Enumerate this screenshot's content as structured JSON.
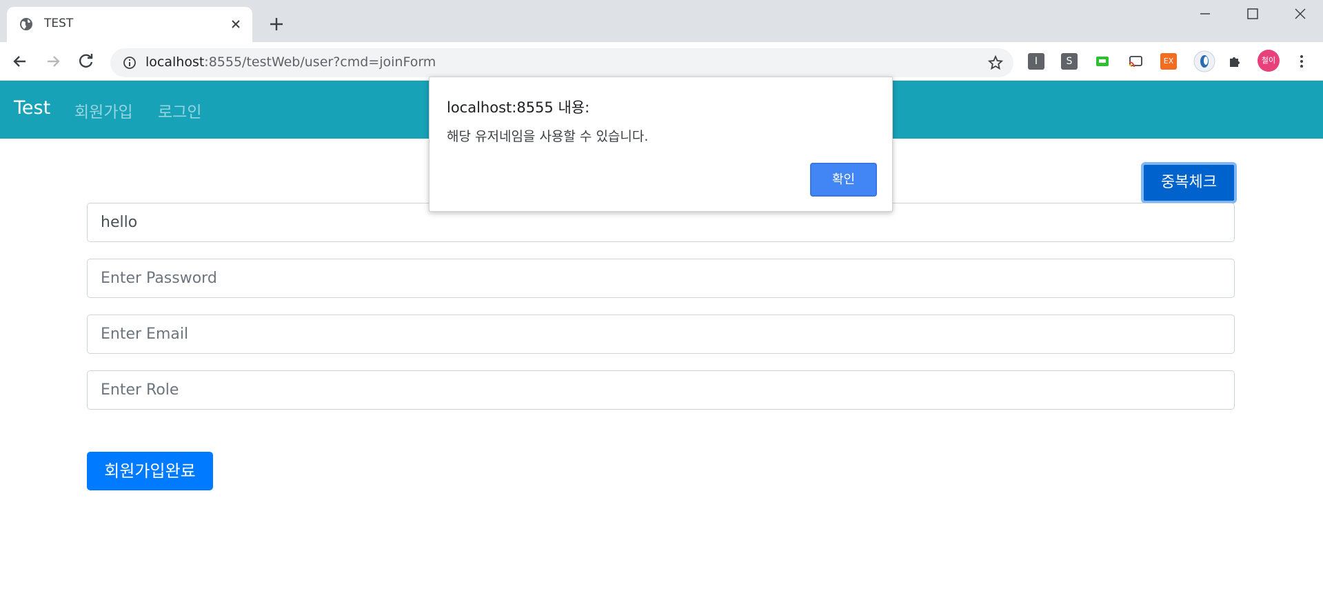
{
  "browser": {
    "tab_title": "TEST",
    "url_host": "localhost",
    "url_rest": ":8555/testWeb/user?cmd=joinForm",
    "extensions": [
      "I",
      "S",
      "EX"
    ],
    "profile_label": "철이"
  },
  "navbar": {
    "brand": "Test",
    "links": [
      "회원가입",
      "로그인"
    ],
    "color": "#17a2b8"
  },
  "form": {
    "duplicate_check_label": "중복체크",
    "username_value": "hello",
    "password_placeholder": "Enter Password",
    "email_placeholder": "Enter Email",
    "role_placeholder": "Enter Role",
    "submit_label": "회원가입완료"
  },
  "dialog": {
    "title": "localhost:8555 내용:",
    "message": "해당 유저네임을 사용할 수 있습니다.",
    "ok_label": "확인"
  }
}
